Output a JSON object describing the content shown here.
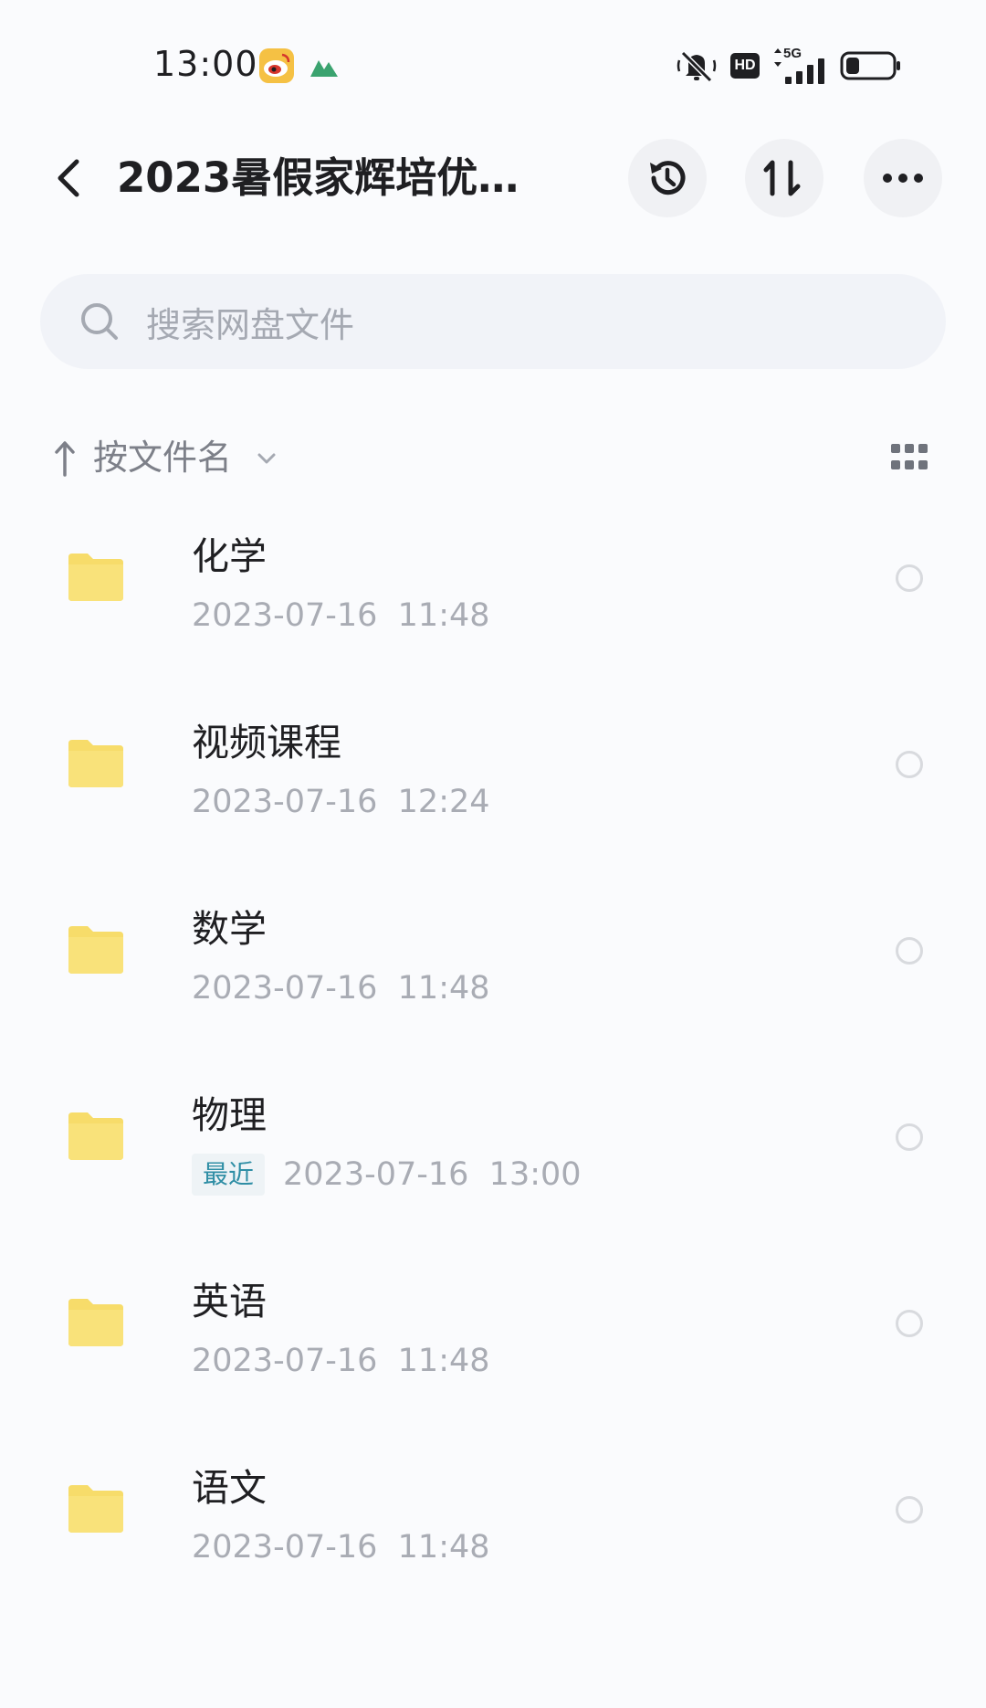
{
  "status_bar": {
    "time": "13:00",
    "network": "5G",
    "hd": "HD",
    "icons": [
      "weibo-icon",
      "mountain-icon",
      "mute-icon",
      "signal-icon",
      "battery-icon"
    ]
  },
  "header": {
    "title": "2023暑假家辉培优…",
    "actions": [
      "history-icon",
      "sort-icon",
      "more-icon"
    ]
  },
  "search": {
    "placeholder": "搜索网盘文件"
  },
  "sort": {
    "label": "按文件名"
  },
  "files": [
    {
      "name": "化学",
      "date": "2023-07-16  11:48",
      "tag": ""
    },
    {
      "name": "视频课程",
      "date": "2023-07-16  12:24",
      "tag": ""
    },
    {
      "name": "数学",
      "date": "2023-07-16  11:48",
      "tag": ""
    },
    {
      "name": "物理",
      "date": "2023-07-16  13:00",
      "tag": "最近"
    },
    {
      "name": "英语",
      "date": "2023-07-16  11:48",
      "tag": ""
    },
    {
      "name": "语文",
      "date": "2023-07-16  11:48",
      "tag": ""
    }
  ],
  "colors": {
    "folder": "#f7dc6a",
    "accent_tag": "#2f8ea5",
    "text_primary": "#1f1f22",
    "text_secondary": "#a9acb4"
  }
}
